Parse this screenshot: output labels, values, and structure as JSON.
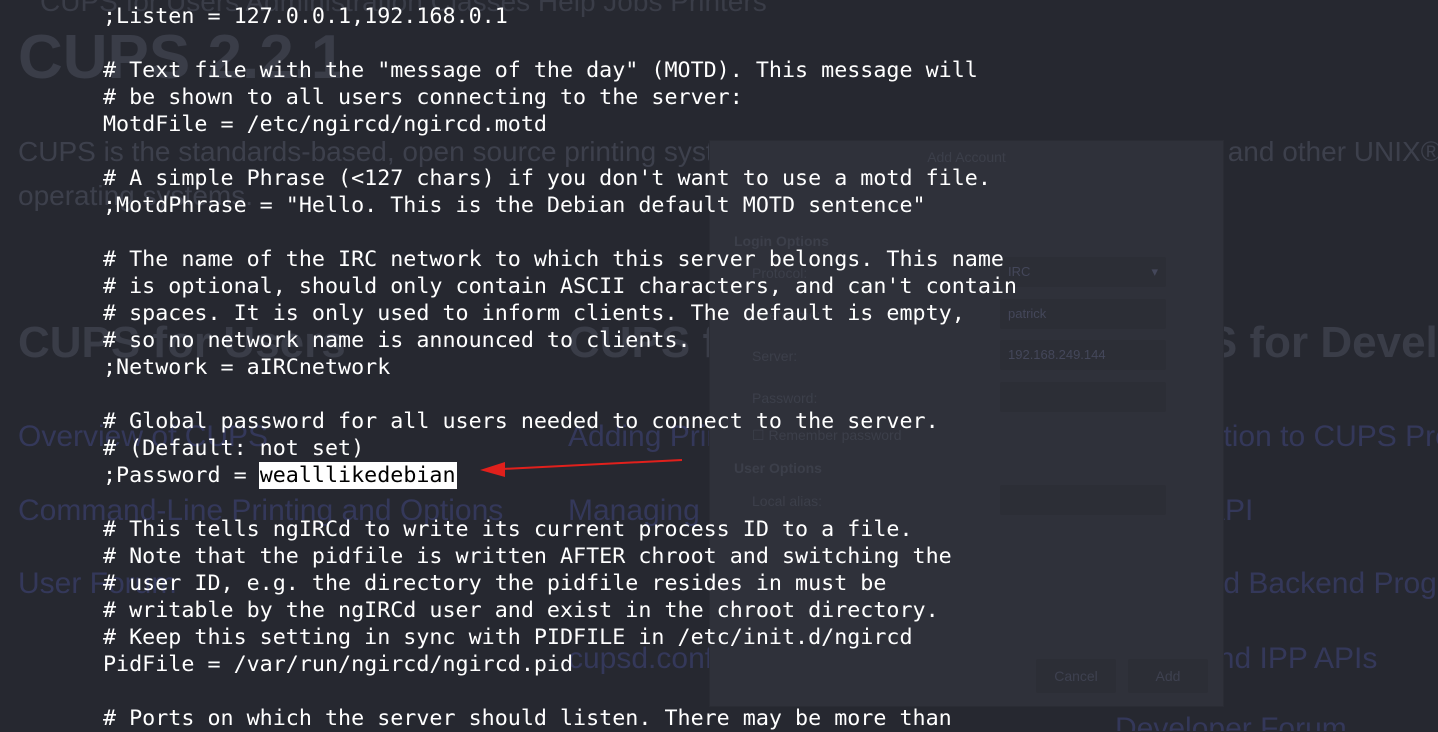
{
  "background_page": {
    "nav_text": "CUPS for Users   Administration   Classes   Help   Jobs   Printers",
    "title": "CUPS 2.2.1",
    "intro_line1": "CUPS is the standards-based, open source printing system developed by Apple Inc. for macOS® and other UNIX®-like",
    "intro_line2": "operating systems.",
    "heading_users": "CUPS for Users",
    "heading_admins": "CUPS for Administrators",
    "heading_devs": "CUPS for Developers",
    "links_left": [
      "Overview of CUPS",
      "Command-Line Printing and Options",
      "User Forum"
    ],
    "links_mid": [
      "Adding Printers and Classes",
      "Managing Operation Policies",
      "cupsd.conf Reference"
    ],
    "links_right": [
      "Introduction to CUPS Programming",
      "CUPS API",
      "Filter and Backend Programming",
      "HTTP and IPP APIs",
      "Developer Forum"
    ]
  },
  "dialog": {
    "title": "Add Account",
    "section_login": "Login Options",
    "protocol_label": "Protocol:",
    "protocol_value": "IRC",
    "username_label": "Username:",
    "username_value": "patrick",
    "server_label": "Server:",
    "server_value": "192.168.249.144",
    "password_label": "Password:",
    "remember_label": "Remember password",
    "section_user": "User Options",
    "alias_label": "Local alias:",
    "cancel_label": "Cancel",
    "add_label": "Add"
  },
  "terminal": {
    "lines": [
      ";Listen = 127.0.0.1,192.168.0.1",
      "",
      "# Text file with the \"message of the day\" (MOTD). This message will",
      "# be shown to all users connecting to the server:",
      "MotdFile = /etc/ngircd/ngircd.motd",
      "",
      "# A simple Phrase (<127 chars) if you don't want to use a motd file.",
      ";MotdPhrase = \"Hello. This is the Debian default MOTD sentence\"",
      "",
      "# The name of the IRC network to which this server belongs. This name",
      "# is optional, should only contain ASCII characters, and can't contain",
      "# spaces. It is only used to inform clients. The default is empty,",
      "# so no network name is announced to clients.",
      ";Network = aIRCnetwork",
      "",
      "# Global password for all users needed to connect to the server.",
      "# (Default: not set)",
      "",
      "",
      "# This tells ngIRCd to write its current process ID to a file.",
      "# Note that the pidfile is written AFTER chroot and switching the",
      "# user ID, e.g. the directory the pidfile resides in must be",
      "# writable by the ngIRCd user and exist in the chroot directory.",
      "# Keep this setting in sync with PIDFILE in /etc/init.d/ngircd",
      "PidFile = /var/run/ngircd/ngircd.pid",
      "",
      "# Ports on which the server should listen. There may be more than"
    ],
    "password_prefix": ";Password = ",
    "password_value": "wealllikedebian"
  },
  "annotation": {
    "arrow_color": "#e0201c"
  }
}
